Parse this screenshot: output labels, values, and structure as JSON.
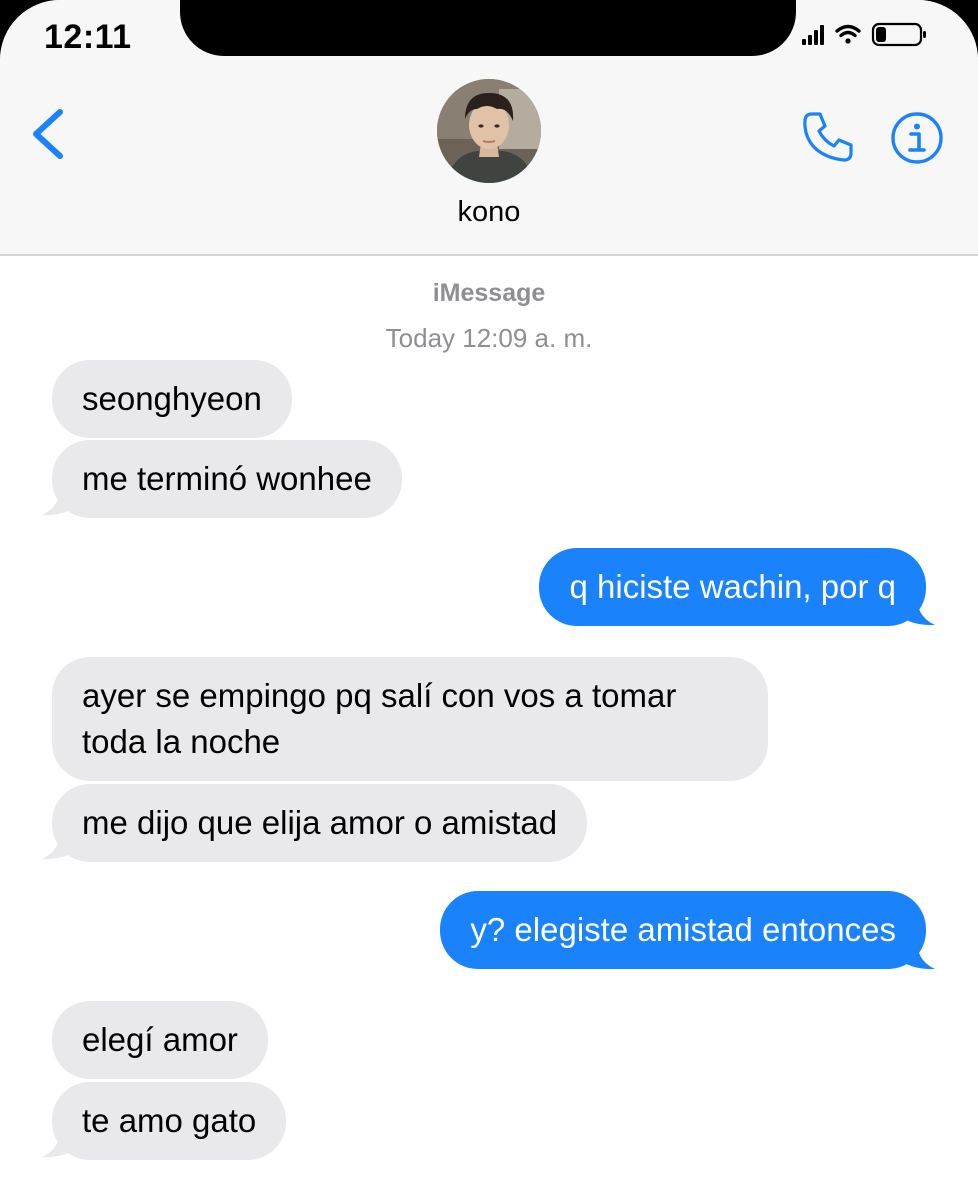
{
  "status_bar": {
    "time": "12:11",
    "icons": [
      "cellular-signal-icon",
      "wifi-icon",
      "battery-icon"
    ]
  },
  "nav": {
    "back_icon": "chevron-left-icon",
    "contact_name": "kono",
    "call_icon": "phone-icon",
    "info_icon": "info-icon"
  },
  "conversation": {
    "service": "iMessage",
    "timestamp": "Today 12:09 a. m.",
    "messages": [
      {
        "from": "them",
        "text": "seonghyeon"
      },
      {
        "from": "them",
        "text": "me terminó wonhee"
      },
      {
        "from": "me",
        "text": "q hiciste wachin, por q"
      },
      {
        "from": "them",
        "text": "ayer se empingo pq salí con vos a tomar toda la noche"
      },
      {
        "from": "them",
        "text": "me dijo que elija amor o amistad"
      },
      {
        "from": "me",
        "text": "y? elegiste amistad entonces"
      },
      {
        "from": "them",
        "text": "elegí amor"
      },
      {
        "from": "them",
        "text": "te amo gato"
      }
    ]
  },
  "colors": {
    "accent": "#1a82fb",
    "incoming_bubble": "#e9e9eb",
    "header_bg": "#f7f7f7",
    "secondary_text": "#8e8e93"
  }
}
